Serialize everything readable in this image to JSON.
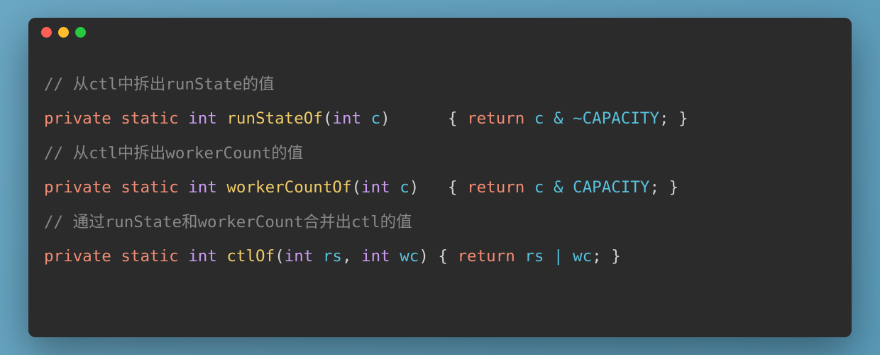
{
  "code": {
    "lines": [
      {
        "type": "comment",
        "text": "// 从ctl中拆出runState的值"
      },
      {
        "type": "method",
        "modifier1": "private",
        "modifier2": "static",
        "returnType": "int",
        "methodName": "runStateOf",
        "paramType": "int",
        "paramName": "c",
        "padding": "     ",
        "returnKeyword": "return",
        "bodyVar": "c",
        "bodyOp": "&",
        "bodyPrefix": "~",
        "bodyConst": "CAPACITY"
      },
      {
        "type": "comment",
        "text": "// 从ctl中拆出workerCount的值"
      },
      {
        "type": "method",
        "modifier1": "private",
        "modifier2": "static",
        "returnType": "int",
        "methodName": "workerCountOf",
        "paramType": "int",
        "paramName": "c",
        "padding": "  ",
        "returnKeyword": "return",
        "bodyVar": "c",
        "bodyOp": "&",
        "bodyPrefix": "",
        "bodyConst": "CAPACITY"
      },
      {
        "type": "comment",
        "text": "// 通过runState和workerCount合并出ctl的值"
      },
      {
        "type": "method2",
        "modifier1": "private",
        "modifier2": "static",
        "returnType": "int",
        "methodName": "ctlOf",
        "param1Type": "int",
        "param1Name": "rs",
        "param2Type": "int",
        "param2Name": "wc",
        "padding": "",
        "returnKeyword": "return",
        "bodyVar1": "rs",
        "bodyOp": "|",
        "bodyVar2": "wc"
      }
    ]
  }
}
